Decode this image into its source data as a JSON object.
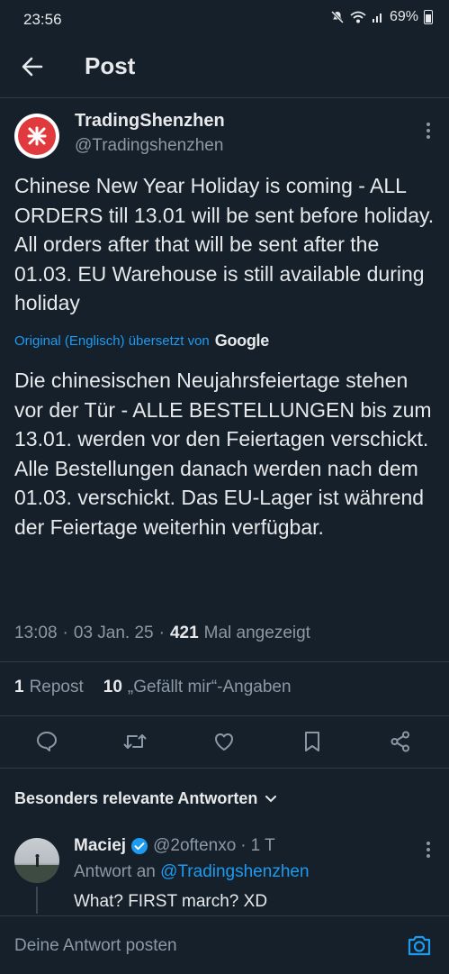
{
  "status_bar": {
    "time": "23:56",
    "battery": "69%"
  },
  "header": {
    "title": "Post"
  },
  "tweet": {
    "author_name": "TradingShenzhen",
    "author_handle": "@Tradingshenzhen",
    "text": "Chinese New Year Holiday is coming - ALL ORDERS till 13.01 will be sent before holiday. All orders after that will be sent after the 01.03.  EU Warehouse is still available during holiday",
    "translation_note": "Original (Englisch) übersetzt von",
    "translation_provider": "Google",
    "translated_text": "Die chinesischen Neujahrsfeiertage stehen vor der Tür - ALLE BESTELLUNGEN bis zum 13.01. werden vor den Feiertagen verschickt. Alle Bestellungen danach werden nach dem 01.03. verschickt. Das EU-Lager ist während der Feiertage weiterhin verfügbar.",
    "time": "13:08",
    "date": "03 Jan. 25",
    "views_count": "421",
    "views_label": "Mal angezeigt",
    "reposts_count": "1",
    "reposts_label": "Repost",
    "likes_count": "10",
    "likes_label": "„Gefällt mir“-Angaben"
  },
  "actions": [
    "reply-icon",
    "repost-icon",
    "like-icon",
    "bookmark-icon",
    "share-icon"
  ],
  "replies_section": {
    "title": "Besonders relevante Antworten"
  },
  "reply": {
    "name": "Maciej",
    "handle": "@2oftenxo",
    "age": "1 T",
    "replying_to_label": "Antwort an",
    "replying_to_handle": "@Tradingshenzhen",
    "text": "What? FIRST march? XD"
  },
  "compose": {
    "placeholder": "Deine Antwort posten"
  },
  "colors": {
    "background": "#15202b",
    "accent": "#1d9bf0",
    "muted": "#8b98a5",
    "brand_red": "#e03a3e"
  }
}
